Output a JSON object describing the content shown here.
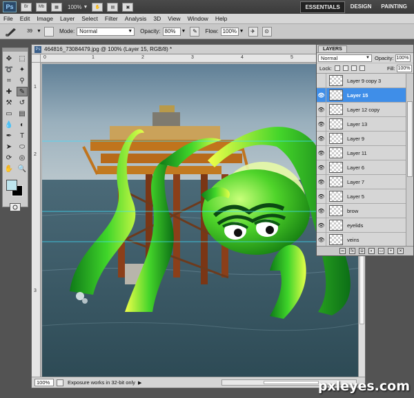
{
  "appbar": {
    "logo": "Ps",
    "icons": [
      "Br",
      "Mb"
    ],
    "zoom": "100%",
    "workspaces": [
      {
        "label": "ESSENTIALS",
        "active": true
      },
      {
        "label": "DESIGN",
        "active": false
      },
      {
        "label": "PAINTING",
        "active": false
      }
    ]
  },
  "menubar": {
    "items": [
      "File",
      "Edit",
      "Image",
      "Layer",
      "Select",
      "Filter",
      "Analysis",
      "3D",
      "View",
      "Window",
      "Help"
    ]
  },
  "options": {
    "brush_size": "39",
    "mode_label": "Mode:",
    "mode_value": "Normal",
    "opacity_label": "Opacity:",
    "opacity_value": "80%",
    "flow_label": "Flow:",
    "flow_value": "100%"
  },
  "document": {
    "tab_title": "464816_73084479.jpg @ 100% (Layer 15, RGB/8) *",
    "ruler_h_marks": [
      "0",
      "1",
      "2",
      "3",
      "4",
      "5",
      "6"
    ],
    "ruler_v_marks": [
      "1",
      "2",
      "3"
    ],
    "zoom": "100%",
    "status": "Exposure works in 32-bit only"
  },
  "layers_panel": {
    "tab": "LAYERS",
    "blend_mode": "Normal",
    "opacity_label": "Opacity:",
    "opacity_value": "100%",
    "lock_label": "Lock:",
    "fill_label": "Fill:",
    "fill_value": "100%",
    "layers": [
      {
        "name": "Layer 9 copy 3",
        "visible": false,
        "selected": false
      },
      {
        "name": "Layer 15",
        "visible": true,
        "selected": true
      },
      {
        "name": "Layer 12 copy",
        "visible": true,
        "selected": false
      },
      {
        "name": "Layer 13",
        "visible": true,
        "selected": false
      },
      {
        "name": "Layer 9",
        "visible": true,
        "selected": false
      },
      {
        "name": "Layer 11",
        "visible": true,
        "selected": false
      },
      {
        "name": "Layer 6",
        "visible": true,
        "selected": false
      },
      {
        "name": "Layer 7",
        "visible": true,
        "selected": false
      },
      {
        "name": "Layer 5",
        "visible": true,
        "selected": false
      },
      {
        "name": "brow",
        "visible": true,
        "selected": false
      },
      {
        "name": "eyelids",
        "visible": true,
        "selected": false
      },
      {
        "name": "veins",
        "visible": true,
        "selected": false
      }
    ]
  },
  "watermark": "pxleyes.com",
  "colors": {
    "foreground": "#bfe6ef",
    "background": "#000000",
    "selection": "#3f8ee8",
    "monster": "#2fbf1f"
  }
}
